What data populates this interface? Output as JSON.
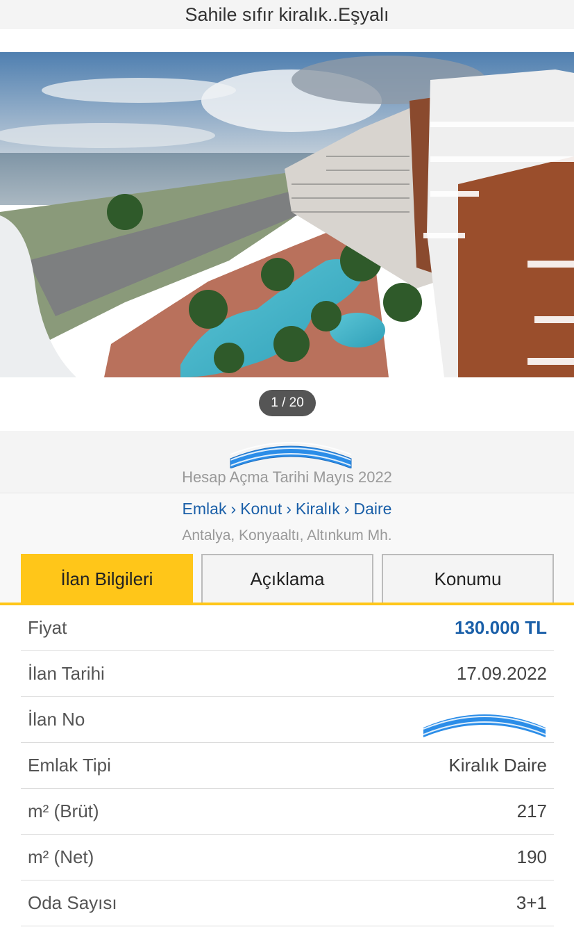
{
  "header": {
    "title": "Sahile sıfır kiralık..Eşyalı"
  },
  "gallery": {
    "counter": "1 / 20"
  },
  "owner": {
    "account_date": "Hesap Açma Tarihi  Mayıs 2022"
  },
  "breadcrumb": {
    "items": [
      "Emlak",
      "Konut",
      "Kiralık",
      "Daire"
    ],
    "separator": "›"
  },
  "location": "Antalya, Konyaaltı, Altınkum Mh.",
  "tabs": [
    {
      "label": "İlan Bilgileri",
      "active": true
    },
    {
      "label": "Açıklama",
      "active": false
    },
    {
      "label": "Konumu",
      "active": false
    }
  ],
  "details": [
    {
      "label": "Fiyat",
      "value": "130.000 TL"
    },
    {
      "label": "İlan Tarihi",
      "value": "17.09.2022"
    },
    {
      "label": "İlan No",
      "value": ""
    },
    {
      "label": "Emlak Tipi",
      "value": "Kiralık Daire"
    },
    {
      "label": "m² (Brüt)",
      "value": "217"
    },
    {
      "label": "m² (Net)",
      "value": "190"
    },
    {
      "label": "Oda Sayısı",
      "value": "3+1"
    }
  ],
  "colors": {
    "accent": "#ffc619",
    "link": "#1a5fa8",
    "price": "#1a5fa8"
  }
}
